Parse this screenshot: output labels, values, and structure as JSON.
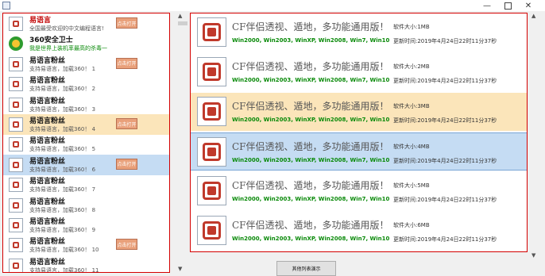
{
  "window": {
    "controls": [
      "—",
      "□",
      "✕"
    ]
  },
  "left_list": [
    {
      "name": "易语言",
      "desc": "全国最受欢迎的中文编程语言!",
      "button": "点击打开",
      "name_color": "red",
      "icon": "app-icon"
    },
    {
      "name": "360安全卫士",
      "desc": "我是世界上装机率最高的杀毒一",
      "button": "",
      "name_color": "black",
      "desc_color": "green",
      "icon": "360-icon"
    },
    {
      "name": "易语言粉丝",
      "desc": "支持易语言，加载360！  1",
      "button": "点击打开",
      "icon": "app-icon"
    },
    {
      "name": "易语言粉丝",
      "desc": "支持易语言，加载360！  2",
      "button": "",
      "icon": "app-icon"
    },
    {
      "name": "易语言粉丝",
      "desc": "支持易语言，加载360！  3",
      "button": "",
      "icon": "app-icon"
    },
    {
      "name": "易语言粉丝",
      "desc": "支持易语言，加载360！  4",
      "button": "点击打开",
      "highlight": "yellow",
      "icon": "app-icon"
    },
    {
      "name": "易语言粉丝",
      "desc": "支持易语言，加载360！  5",
      "button": "",
      "icon": "app-icon"
    },
    {
      "name": "易语言粉丝",
      "desc": "支持易语言，加载360！  6",
      "button": "点击打开",
      "highlight": "blue",
      "icon": "app-icon"
    },
    {
      "name": "易语言粉丝",
      "desc": "支持易语言，加载360！  7",
      "button": "",
      "icon": "app-icon"
    },
    {
      "name": "易语言粉丝",
      "desc": "支持易语言，加载360！  8",
      "button": "",
      "icon": "app-icon"
    },
    {
      "name": "易语言粉丝",
      "desc": "支持易语言，加载360！  9",
      "button": "",
      "icon": "app-icon"
    },
    {
      "name": "易语言粉丝",
      "desc": "支持易语言，加载360！  10",
      "button": "点击打开",
      "icon": "app-icon"
    },
    {
      "name": "易语言粉丝",
      "desc": "支持易语言，加载360！  11",
      "button": "",
      "icon": "app-icon"
    }
  ],
  "right_list": [
    {
      "title": "CF伴侣透视、遁地，多功能通用版！",
      "os": "Win2000, Win2003, WinXP, Win2008, Win7, Win10",
      "size": "软件大小:1MB",
      "time": "更新时间:2019年4月24日22时11分37秒"
    },
    {
      "title": "CF伴侣透视、遁地，多功能通用版！",
      "os": "Win2000, Win2003, WinXP, Win2008, Win7, Win10",
      "size": "软件大小:2MB",
      "time": "更新时间:2019年4月24日22时11分37秒"
    },
    {
      "title": "CF伴侣透视、遁地，多功能通用版！",
      "os": "Win2000, Win2003, WinXP, Win2008, Win7, Win10",
      "size": "软件大小:3MB",
      "time": "更新时间:2019年4月24日22时11分37秒",
      "highlight": "yellow"
    },
    {
      "title": "CF伴侣透视、遁地，多功能通用版！",
      "os": "Win2000, Win2003, WinXP, Win2008, Win7, Win10",
      "size": "软件大小:4MB",
      "time": "更新时间:2019年4月24日22时11分37秒",
      "highlight": "blue"
    },
    {
      "title": "CF伴侣透视、遁地，多功能通用版！",
      "os": "Win2000, Win2003, WinXP, Win2008, Win7, Win10",
      "size": "软件大小:5MB",
      "time": "更新时间:2019年4月24日22时11分37秒"
    },
    {
      "title": "CF伴侣透视、遁地，多功能通用版！",
      "os": "Win2000, Win2003, WinXP, Win2008, Win7, Win10",
      "size": "软件大小:6MB",
      "time": "更新时间:2019年4月24日22时11分37秒"
    }
  ],
  "footer": {
    "button_label": "其他列表演示"
  },
  "colors": {
    "frame": "#d40000",
    "yellow_highlight": "#fbe5ba",
    "blue_highlight": "#c5dcf3",
    "button": "#e9a07a",
    "os_text": "#0a8a0a"
  }
}
